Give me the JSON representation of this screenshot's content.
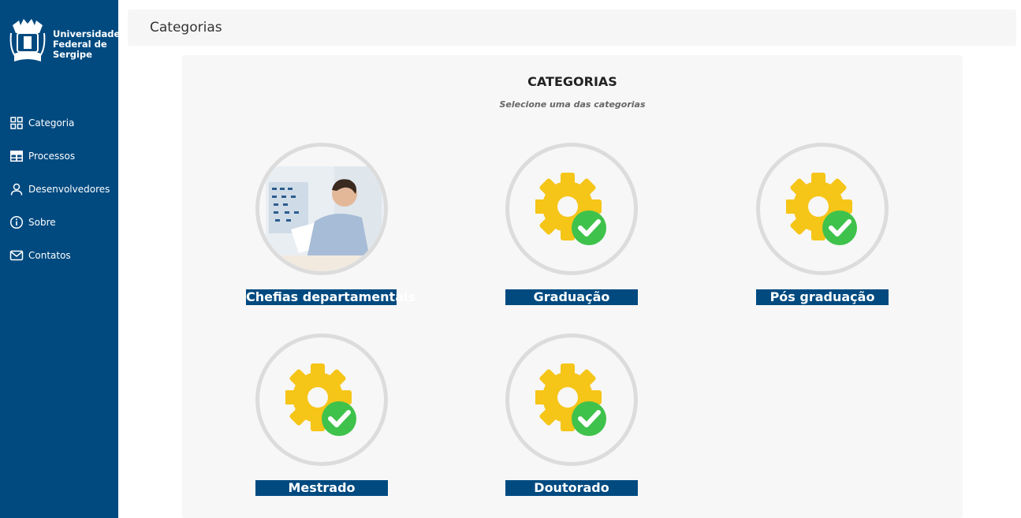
{
  "sidebar": {
    "logo_text": [
      "Universidade",
      "Federal de",
      "Sergipe"
    ],
    "items": [
      {
        "label": "Categoria",
        "icon": "grid-icon"
      },
      {
        "label": "Processos",
        "icon": "table-icon"
      },
      {
        "label": "Desenvolvedores",
        "icon": "user-icon"
      },
      {
        "label": "Sobre",
        "icon": "info-icon"
      },
      {
        "label": "Contatos",
        "icon": "mail-icon"
      }
    ]
  },
  "header": {
    "title": "Categorias"
  },
  "main": {
    "title": "CATEGORIAS",
    "subtitle": "Selecione uma das categorias",
    "categories": [
      {
        "label": "Chefias departamentais",
        "icon": "person-photo"
      },
      {
        "label": "Graduação",
        "icon": "gear-check-icon"
      },
      {
        "label": "Pós graduação",
        "icon": "gear-check-icon"
      },
      {
        "label": "Mestrado",
        "icon": "gear-check-icon"
      },
      {
        "label": "Doutorado",
        "icon": "gear-check-icon"
      }
    ]
  },
  "colors": {
    "sidebar": "#004a80",
    "label_bg": "#004a80",
    "gear": "#f5c518",
    "check": "#3fc24b"
  }
}
